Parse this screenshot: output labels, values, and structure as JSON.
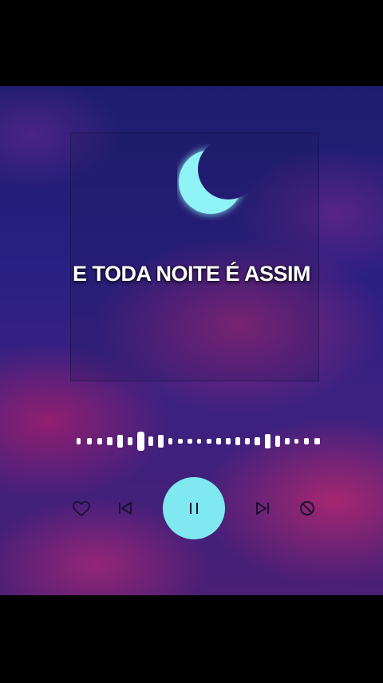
{
  "lyric": {
    "text": "E TODA NOITE É ASSIM"
  },
  "player": {
    "state": "playing",
    "progress": 0.2,
    "controls": [
      "heart-icon",
      "previous-icon",
      "pause-icon",
      "next-icon",
      "block-icon"
    ]
  },
  "colors": {
    "accent": "#7fe8f0",
    "moon": "#8ff3f5",
    "icon": "#1a1030"
  }
}
